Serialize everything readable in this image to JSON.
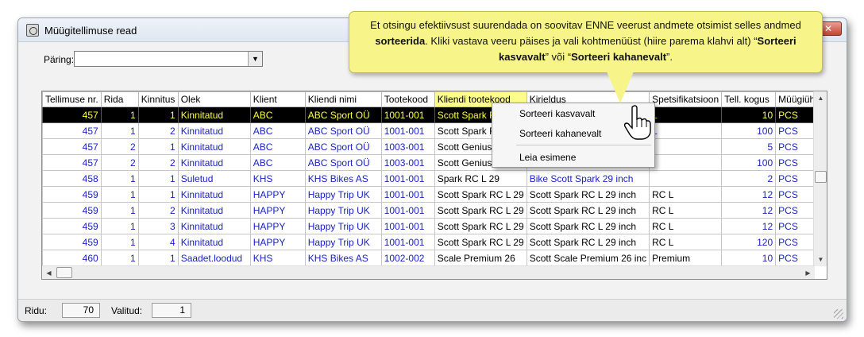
{
  "window": {
    "title": "Müügitellimuse read",
    "close_label": "✕"
  },
  "query": {
    "label": "Päring:",
    "value": ""
  },
  "grid": {
    "columns": [
      "Tellimuse nr.",
      "Rida",
      "Kinnitus",
      "Olek",
      "Klient",
      "Kliendi nimi",
      "Tootekood",
      "Kliendi tootekood",
      "Kirjeldus",
      "Spetsifikatsioon",
      "Tell. kogus",
      "Müügiühik"
    ],
    "rows": [
      [
        "457",
        "1",
        "1",
        "Kinnitatud",
        "ABC",
        "ABC Sport OÜ",
        "1001-001",
        "Scott Spark R",
        "",
        "L",
        "10",
        "PCS"
      ],
      [
        "457",
        "1",
        "2",
        "Kinnitatud",
        "ABC",
        "ABC Sport OÜ",
        "1001-001",
        "Scott Spark R",
        "",
        "L",
        "100",
        "PCS"
      ],
      [
        "457",
        "2",
        "1",
        "Kinnitatud",
        "ABC",
        "ABC Sport OÜ",
        "1003-001",
        "Scott Genius",
        "",
        "",
        "5",
        "PCS"
      ],
      [
        "457",
        "2",
        "2",
        "Kinnitatud",
        "ABC",
        "ABC Sport OÜ",
        "1003-001",
        "Scott Genius",
        "",
        "",
        "100",
        "PCS"
      ],
      [
        "458",
        "1",
        "1",
        "Suletud",
        "KHS",
        "KHS Bikes AS",
        "1001-001",
        "Spark RC L 29",
        "Bike Scott Spark 29 inch",
        "",
        "2",
        "PCS"
      ],
      [
        "459",
        "1",
        "1",
        "Kinnitatud",
        "HAPPY",
        "Happy Trip UK",
        "1001-001",
        "Scott Spark RC L 29",
        "Scott Spark RC L 29 inch",
        "RC L",
        "12",
        "PCS"
      ],
      [
        "459",
        "1",
        "2",
        "Kinnitatud",
        "HAPPY",
        "Happy Trip UK",
        "1001-001",
        "Scott Spark RC L 29",
        "Scott Spark RC L 29 inch",
        "RC L",
        "12",
        "PCS"
      ],
      [
        "459",
        "1",
        "3",
        "Kinnitatud",
        "HAPPY",
        "Happy Trip UK",
        "1001-001",
        "Scott Spark RC L 29",
        "Scott Spark RC L 29 inch",
        "RC L",
        "12",
        "PCS"
      ],
      [
        "459",
        "1",
        "4",
        "Kinnitatud",
        "HAPPY",
        "Happy Trip UK",
        "1001-001",
        "Scott Spark RC L 29",
        "Scott Spark RC L 29 inch",
        "RC L",
        "120",
        "PCS"
      ],
      [
        "460",
        "1",
        "1",
        "Saadet.loodud",
        "KHS",
        "KHS Bikes AS",
        "1002-002",
        "Scale Premium 26",
        "Scott Scale Premium 26 inc",
        "Premium",
        "10",
        "PCS"
      ]
    ]
  },
  "context_menu": {
    "items": [
      "Sorteeri kasvavalt",
      "Sorteeri kahanevalt",
      "Leia esimene"
    ]
  },
  "tooltip": {
    "part1": "Et otsingu  efektiivsust suurendada on soovitav ENNE veerust andmete otsimist selles andmed ",
    "bold1": "sorteerida",
    "part2": ". Kliki vastava veeru päises ja vali kohtmenüüst (hiire parema klahvi alt) “",
    "bold2": "Sorteeri kasvavalt",
    "part3": "” või “",
    "bold3": "Sorteeri kahanevalt",
    "part4": "”."
  },
  "status": {
    "rows_label": "Ridu:",
    "rows_value": "70",
    "selected_label": "Valitud:",
    "selected_value": "1"
  },
  "icons": {
    "app": "app-icon",
    "cursor": "hand-pointer-icon",
    "dropdown": "chevron-down-icon",
    "resize": "resize-grip-icon"
  },
  "colors": {
    "tooltip": "#f7f58a",
    "selected_row_bg": "#000000",
    "selected_row_text": "#ffff3a",
    "cell_text": "#1a22c8",
    "highlight_header": "#fcfc8c"
  }
}
